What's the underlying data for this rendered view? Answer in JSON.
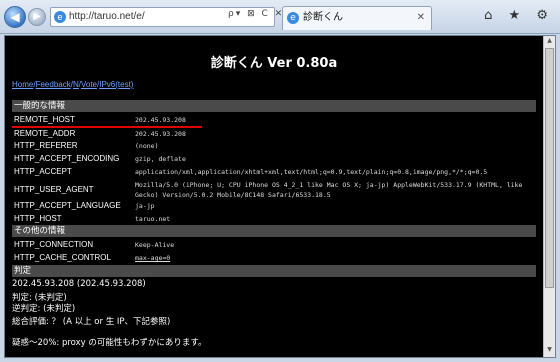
{
  "browser": {
    "address": "http://taruo.net/e/",
    "address_tools": "ρ▾ ⊠ C ✕",
    "tab_label": "診断くん",
    "tab_close": "✕",
    "right_icons": "⌂ ★ ⚙"
  },
  "page": {
    "title": "診断くん Ver 0.80a",
    "links": [
      "Home",
      "Feedback",
      "N",
      "Vote",
      "IPv6(test)"
    ],
    "sections": {
      "general": "一般的な情報",
      "other": "その他の情報",
      "judge": "判定"
    },
    "general_rows": [
      {
        "key": "REMOTE_HOST",
        "value": "202.45.93.208"
      },
      {
        "key": "REMOTE_ADDR",
        "value": "202.45.93.208"
      },
      {
        "key": "HTTP_REFERER",
        "value": "(none)"
      },
      {
        "key": "HTTP_ACCEPT_ENCODING",
        "value": "gzip, deflate"
      },
      {
        "key": "HTTP_ACCEPT",
        "value": "application/xml,application/xhtml+xml,text/html;q=0.9,text/plain;q=0.8,image/png,*/*;q=0.5"
      },
      {
        "key": "HTTP_USER_AGENT",
        "value": "Mozilla/5.0 (iPhone; U; CPU iPhone OS 4_2_1 like Mac OS X; ja-jp) AppleWebKit/533.17.9 (KHTML, like Gecko) Version/5.0.2 Mobile/8C148 Safari/6533.18.5"
      },
      {
        "key": "HTTP_ACCEPT_LANGUAGE",
        "value": "ja-jp"
      },
      {
        "key": "HTTP_HOST",
        "value": "taruo.net"
      }
    ],
    "other_rows": [
      {
        "key": "HTTP_CONNECTION",
        "value": "Keep-Alive"
      },
      {
        "key": "HTTP_CACHE_CONTROL",
        "value": "max-age=0"
      }
    ],
    "judge_lines": [
      "202.45.93.208 (202.45.93.208)",
      "判定: (未判定)",
      "逆判定: (未判定)",
      "総合評価: ？ (A 以上 or 生 IP、下記参照)",
      "疑惑〜20%: proxy の可能性もわずかにあります。"
    ]
  }
}
